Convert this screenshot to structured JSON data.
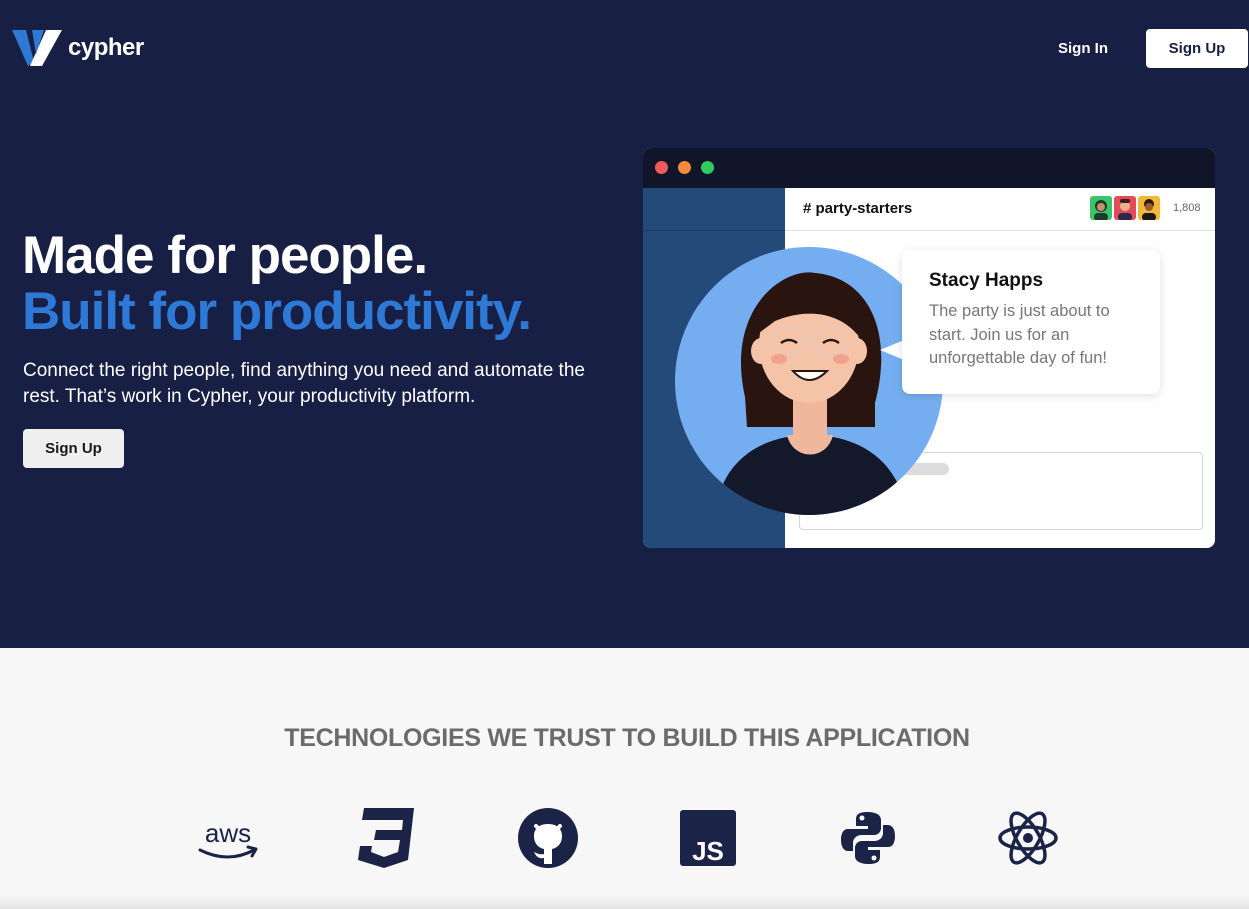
{
  "header": {
    "brand_name": "cypher",
    "sign_in_label": "Sign In",
    "sign_up_label": "Sign Up"
  },
  "hero": {
    "headline_line1": "Made for people.",
    "headline_line2": "Built for productivity.",
    "subtext": "Connect the right people, find anything you need and automate the rest. That’s work in Cypher, your productivity platform.",
    "cta_label": "Sign Up"
  },
  "preview": {
    "channel_name": "# party-starters",
    "member_count": "1,808",
    "message_author": "Stacy Happs",
    "message_text": "The party is just about to start. Join us for an unforgettable day of fun!"
  },
  "technologies": {
    "title": "TECHNOLOGIES WE TRUST TO BUILD THIS APPLICATION",
    "items": [
      "aws-icon",
      "css3-icon",
      "github-icon",
      "javascript-icon",
      "python-icon",
      "react-icon"
    ]
  },
  "colors": {
    "hero_bg": "#181f45",
    "accent_blue": "#2f79d6",
    "icon_navy": "#1b2446",
    "sidebar_blue": "#244a79"
  }
}
